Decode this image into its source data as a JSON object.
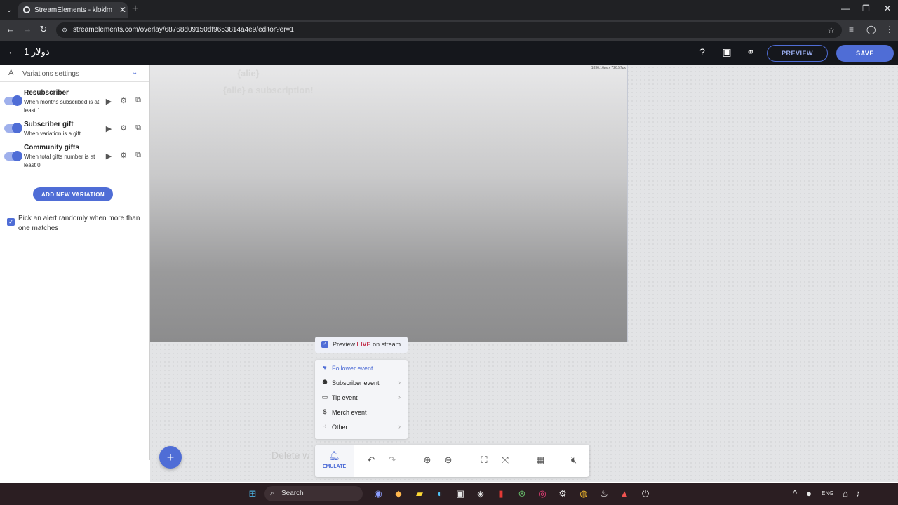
{
  "browser": {
    "tab_title": "StreamElements - kloklm",
    "url": "streamelements.com/overlay/68768d09150df9653814a4e9/editor?er=1"
  },
  "header": {
    "overlay_name": "دولار 1",
    "preview_label": "PREVIEW",
    "save_label": "SAVE"
  },
  "sidebar": {
    "section_title": "Variations settings",
    "variations": [
      {
        "title": "Resubscriber",
        "description": "When months subscribed is at least 1",
        "enabled": true
      },
      {
        "title": "Subscriber gift",
        "description": "When variation is a gift",
        "enabled": true
      },
      {
        "title": "Community gifts",
        "description": "When total gifts number is at least 0",
        "enabled": true
      }
    ],
    "add_variation_label": "ADD NEW VARIATION",
    "random_pick_label": "Pick an alert randomly when more than one matches",
    "random_pick_checked": true
  },
  "canvas": {
    "dimensions_label": "1836.16px x 726.57px",
    "ghost_label": "Delete w"
  },
  "emulate_menu": {
    "preview_prefix": "Preview",
    "preview_live": "LIVE",
    "preview_suffix": "on stream",
    "preview_checked": true,
    "items": [
      {
        "label": "Follower event",
        "icon": "heart-icon",
        "submenu": false
      },
      {
        "label": "Subscriber event",
        "icon": "user-plus-icon",
        "submenu": true
      },
      {
        "label": "Tip event",
        "icon": "card-icon",
        "submenu": true
      },
      {
        "label": "Merch event",
        "icon": "dollar-icon",
        "submenu": false
      },
      {
        "label": "Other",
        "icon": "scatter-icon",
        "submenu": true
      }
    ]
  },
  "toolbar": {
    "emulate_label": "EMULATE"
  },
  "taskbar": {
    "search_placeholder": "Search",
    "language": "ENG"
  },
  "colors": {
    "accent": "#4f6dd6",
    "header_bg": "#15171c",
    "live_red": "#c0213d"
  }
}
